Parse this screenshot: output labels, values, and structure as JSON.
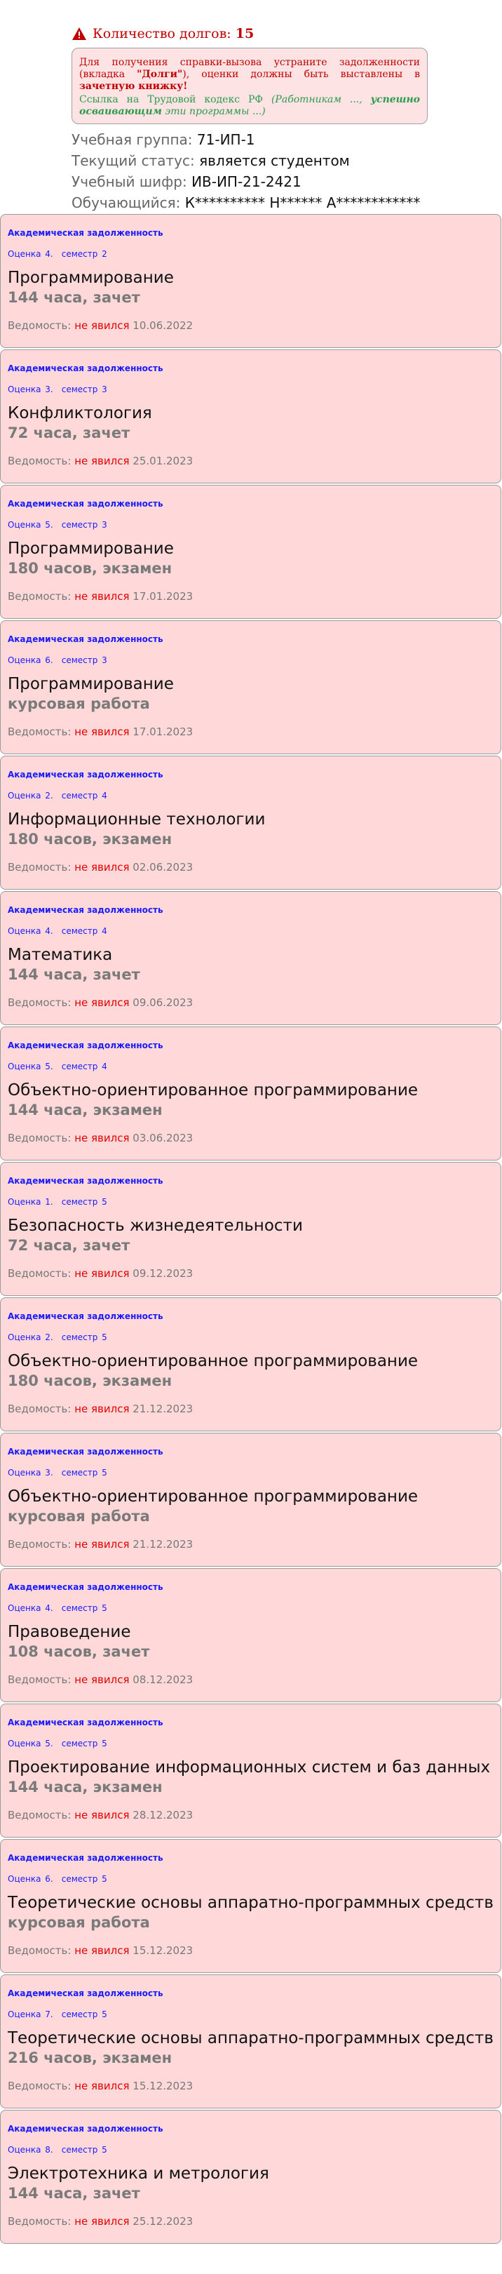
{
  "header": {
    "debt_label": "Количество долгов:",
    "debt_count": "15",
    "notice": {
      "line1": "Для получения справки-вызова устраните задолженности (вкладка ",
      "tab_name": "\"Долги\"",
      "line2": "), оценки должны быть выставлены в ",
      "book": "зачетную книжку!",
      "link_text": "Ссылка на Трудовой кодекс РФ ",
      "link_paren_open": "(Работникам ..., ",
      "link_bold": "успешно осваивающим",
      "link_paren_close": " эти программы ...)"
    },
    "group_label": "Учебная группа:",
    "group_value": "71-ИП-1",
    "status_label": "Текущий статус:",
    "status_value": "является студентом",
    "cipher_label": "Учебный шифр:",
    "cipher_value": "ИВ-ИП-21-2421",
    "student_label": "Обучающийся:",
    "student_value": "К********** Н****** А************"
  },
  "cards": [
    {
      "kind": "Академическая задолженность",
      "grade": "Оценка 4.",
      "semester": "семестр 2",
      "title": "Программирование",
      "hours": "144 часа, зачет",
      "sheet_label": "Ведомость:",
      "absent": "не явился",
      "date": "10.06.2022"
    },
    {
      "kind": "Академическая задолженность",
      "grade": "Оценка 3.",
      "semester": "семестр 3",
      "title": "Конфликтология",
      "hours": "72 часа, зачет",
      "sheet_label": "Ведомость:",
      "absent": "не явился",
      "date": "25.01.2023"
    },
    {
      "kind": "Академическая задолженность",
      "grade": "Оценка 5.",
      "semester": "семестр 3",
      "title": "Программирование",
      "hours": "180 часов, экзамен",
      "sheet_label": "Ведомость:",
      "absent": "не явился",
      "date": "17.01.2023"
    },
    {
      "kind": "Академическая задолженность",
      "grade": "Оценка 6.",
      "semester": "семестр 3",
      "title": "Программирование",
      "hours": "курсовая работа",
      "sheet_label": "Ведомость:",
      "absent": "не явился",
      "date": "17.01.2023"
    },
    {
      "kind": "Академическая задолженность",
      "grade": "Оценка 2.",
      "semester": "семестр 4",
      "title": "Информационные технологии",
      "hours": "180 часов, экзамен",
      "sheet_label": "Ведомость:",
      "absent": "не явился",
      "date": "02.06.2023"
    },
    {
      "kind": "Академическая задолженность",
      "grade": "Оценка 4.",
      "semester": "семестр 4",
      "title": "Математика",
      "hours": "144 часа, зачет",
      "sheet_label": "Ведомость:",
      "absent": "не явился",
      "date": "09.06.2023"
    },
    {
      "kind": "Академическая задолженность",
      "grade": "Оценка 5.",
      "semester": "семестр 4",
      "title": "Объектно-ориентированное программирование",
      "hours": "144 часа, экзамен",
      "sheet_label": "Ведомость:",
      "absent": "не явился",
      "date": "03.06.2023"
    },
    {
      "kind": "Академическая задолженность",
      "grade": "Оценка 1.",
      "semester": "семестр 5",
      "title": "Безопасность жизнедеятельности",
      "hours": "72 часа, зачет",
      "sheet_label": "Ведомость:",
      "absent": "не явился",
      "date": "09.12.2023"
    },
    {
      "kind": "Академическая задолженность",
      "grade": "Оценка 2.",
      "semester": "семестр 5",
      "title": "Объектно-ориентированное программирование",
      "hours": "180 часов, экзамен",
      "sheet_label": "Ведомость:",
      "absent": "не явился",
      "date": "21.12.2023"
    },
    {
      "kind": "Академическая задолженность",
      "grade": "Оценка 3.",
      "semester": "семестр 5",
      "title": "Объектно-ориентированное программирование",
      "hours": "курсовая работа",
      "sheet_label": "Ведомость:",
      "absent": "не явился",
      "date": "21.12.2023"
    },
    {
      "kind": "Академическая задолженность",
      "grade": "Оценка 4.",
      "semester": "семестр 5",
      "title": "Правоведение",
      "hours": "108 часов, зачет",
      "sheet_label": "Ведомость:",
      "absent": "не явился",
      "date": "08.12.2023"
    },
    {
      "kind": "Академическая задолженность",
      "grade": "Оценка 5.",
      "semester": "семестр 5",
      "title": "Проектирование информационных систем и баз данных",
      "hours": "144 часа, экзамен",
      "sheet_label": "Ведомость:",
      "absent": "не явился",
      "date": "28.12.2023"
    },
    {
      "kind": "Академическая задолженность",
      "grade": "Оценка 6.",
      "semester": "семестр 5",
      "title": "Теоретические основы аппаратно-программных средств",
      "hours": "курсовая работа",
      "sheet_label": "Ведомость:",
      "absent": "не явился",
      "date": "15.12.2023"
    },
    {
      "kind": "Академическая задолженность",
      "grade": "Оценка 7.",
      "semester": "семестр 5",
      "title": "Теоретические основы аппаратно-программных средств",
      "hours": "216 часов, экзамен",
      "sheet_label": "Ведомость:",
      "absent": "не явился",
      "date": "15.12.2023"
    },
    {
      "kind": "Академическая задолженность",
      "grade": "Оценка 8.",
      "semester": "семестр 5",
      "title": "Электротехника и метрология",
      "hours": "144 часа, зачет",
      "sheet_label": "Ведомость:",
      "absent": "не явился",
      "date": "25.12.2023"
    }
  ],
  "colors": {
    "card_bg": "#ffd9d9",
    "accent_blue": "#1a1aff",
    "alert_red": "#e00000",
    "link_green": "#2e9a4e"
  }
}
